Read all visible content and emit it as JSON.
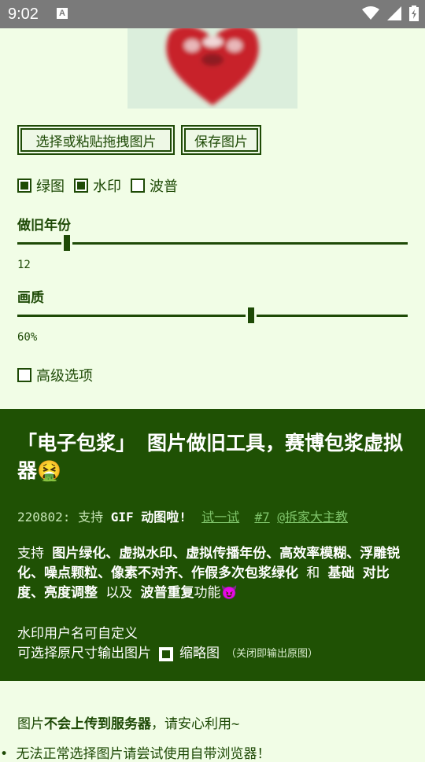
{
  "status_bar": {
    "time": "9:02",
    "notification_icon": "A"
  },
  "actions": {
    "select_label": "选择或粘贴拖拽图片",
    "save_label": "保存图片"
  },
  "options": {
    "green": {
      "label": "绿图",
      "checked": true
    },
    "watermark": {
      "label": "水印",
      "checked": true
    },
    "wave": {
      "label": "波普",
      "checked": false
    }
  },
  "age": {
    "label": "做旧年份",
    "value": "12",
    "fraction": 0.12
  },
  "quality": {
    "label": "画质",
    "value": "60%",
    "fraction": 0.6
  },
  "advanced": {
    "label": "高级选项",
    "checked": false
  },
  "panel": {
    "title": "「电子包浆」 图片做旧工具，赛博包浆虚拟器🤮",
    "update_prefix": "220802: 支持 ",
    "update_strong": "GIF",
    "update_suffix": " 动图啦!",
    "try_link": "试一试",
    "issue_link": "#7",
    "author_link": "@拆家大主教",
    "features_html_parts": [
      "支持 ",
      "图片绿化、虚拟水印、虚拟传播年份、高效率模糊、浮雕锐化、噪点颗粒、像素不对齐、作假多次包浆绿化",
      " 和 ",
      "基础 ",
      "对比度、亮度调整",
      " 以及 ",
      "波普重复",
      "功能😈"
    ],
    "watermark_note": "水印用户名可自定义",
    "original_size_note": "可选择原尺寸输出图片",
    "thumbnail_label": "缩略图",
    "thumbnail_hint": "（关闭即输出原图）"
  },
  "footer": {
    "privacy_prefix": "图片",
    "privacy_strong": "不会上传到服务器",
    "privacy_suffix": "，请安心利用~",
    "browser_tip": "• 无法正常选择图片请尝试使用自带浏览器！"
  },
  "colors": {
    "accent": "#1e4a06",
    "background": "#f1fde6",
    "panel": "#1f5104"
  }
}
